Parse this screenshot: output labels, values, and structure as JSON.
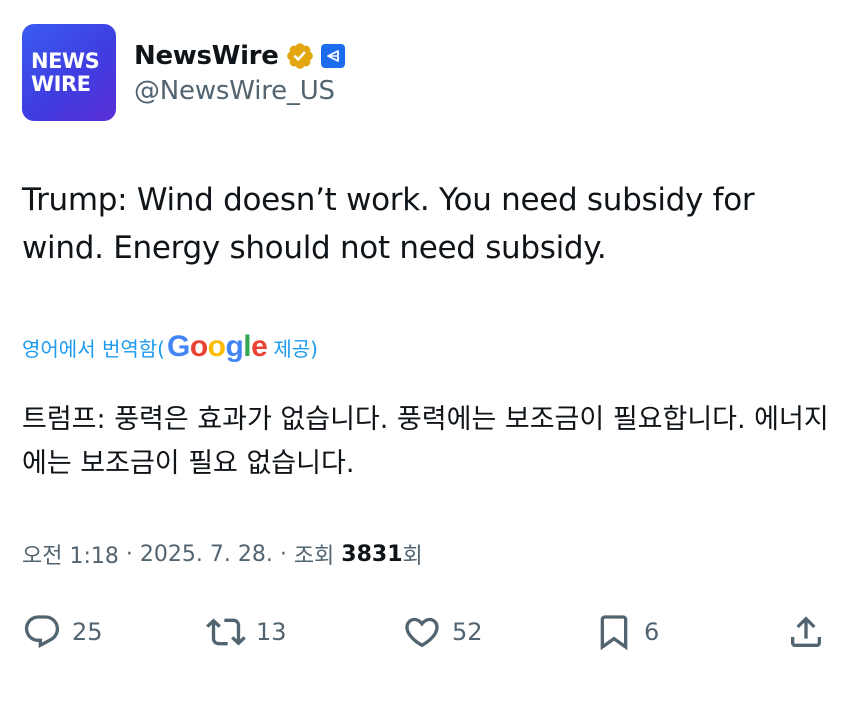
{
  "author": {
    "avatar_text": "NEWS\nWIRE",
    "display_name": "NewsWire",
    "handle": "@NewsWire_US",
    "verified_icon": "verified-badge-gold",
    "affiliate_icon": "affiliate-badge",
    "avatar_colors": [
      "#3a5cf0",
      "#5a2fd6"
    ]
  },
  "tweet": {
    "text": "Trump: Wind doesn’t work. You need subsidy for wind. Energy should not need subsidy."
  },
  "translation": {
    "prefix": "영어에서 번역함(",
    "google_letters": [
      "G",
      "o",
      "o",
      "g",
      "l",
      "e"
    ],
    "suffix": " 제공)",
    "text": "트럼프: 풍력은 효과가 없습니다. 풍력에는 보조금이 필요합니다. 에너지에는 보조금이 필요 없습니다."
  },
  "meta": {
    "time": "오전 1:18",
    "separator": " · ",
    "date": "2025. 7. 28.",
    "views_label": "조회 ",
    "views_count": "3831",
    "views_suffix": "회"
  },
  "actions": {
    "reply": {
      "icon": "reply-icon",
      "count": "25"
    },
    "retweet": {
      "icon": "retweet-icon",
      "count": "13"
    },
    "like": {
      "icon": "heart-icon",
      "count": "52"
    },
    "bookmark": {
      "icon": "bookmark-icon",
      "count": "6"
    },
    "share": {
      "icon": "share-icon"
    }
  },
  "colors": {
    "link": "#1d9bf0",
    "secondary_text": "#536471",
    "primary_text": "#0f1419",
    "verified_gold": "#e2a710",
    "affiliate_blue": "#1d6cf0"
  }
}
